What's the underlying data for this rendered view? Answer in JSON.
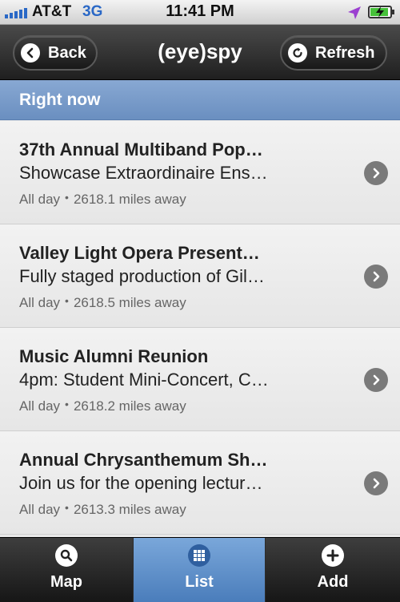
{
  "status_bar": {
    "carrier": "AT&T",
    "network": "3G",
    "time": "11:41 PM"
  },
  "nav": {
    "back_label": "Back",
    "title": "(eye)spy",
    "refresh_label": "Refresh"
  },
  "section": {
    "title": "Right now"
  },
  "events": [
    {
      "title": "37th Annual Multiband Pop…",
      "subtitle": "Showcase Extraordinaire Ens…",
      "when": "All day",
      "separator": "•",
      "distance": "2618.1 miles away"
    },
    {
      "title": "Valley Light Opera Present…",
      "subtitle": "Fully staged production of Gil…",
      "when": "All day",
      "separator": "•",
      "distance": "2618.5 miles away"
    },
    {
      "title": "Music Alumni Reunion",
      "subtitle": "4pm: Student Mini-Concert, C…",
      "when": "All day",
      "separator": "•",
      "distance": "2618.2 miles away"
    },
    {
      "title": "Annual Chrysanthemum Sh…",
      "subtitle": "Join us for the opening lectur…",
      "when": "All day",
      "separator": "•",
      "distance": "2613.3 miles away"
    }
  ],
  "tabs": [
    {
      "label": "Map",
      "icon": "search-icon"
    },
    {
      "label": "List",
      "icon": "grid-icon",
      "selected": true
    },
    {
      "label": "Add",
      "icon": "plus-icon"
    }
  ],
  "colors": {
    "accent": "#6a8fc0",
    "network": "#2a68c6",
    "battery": "#46c13a"
  }
}
